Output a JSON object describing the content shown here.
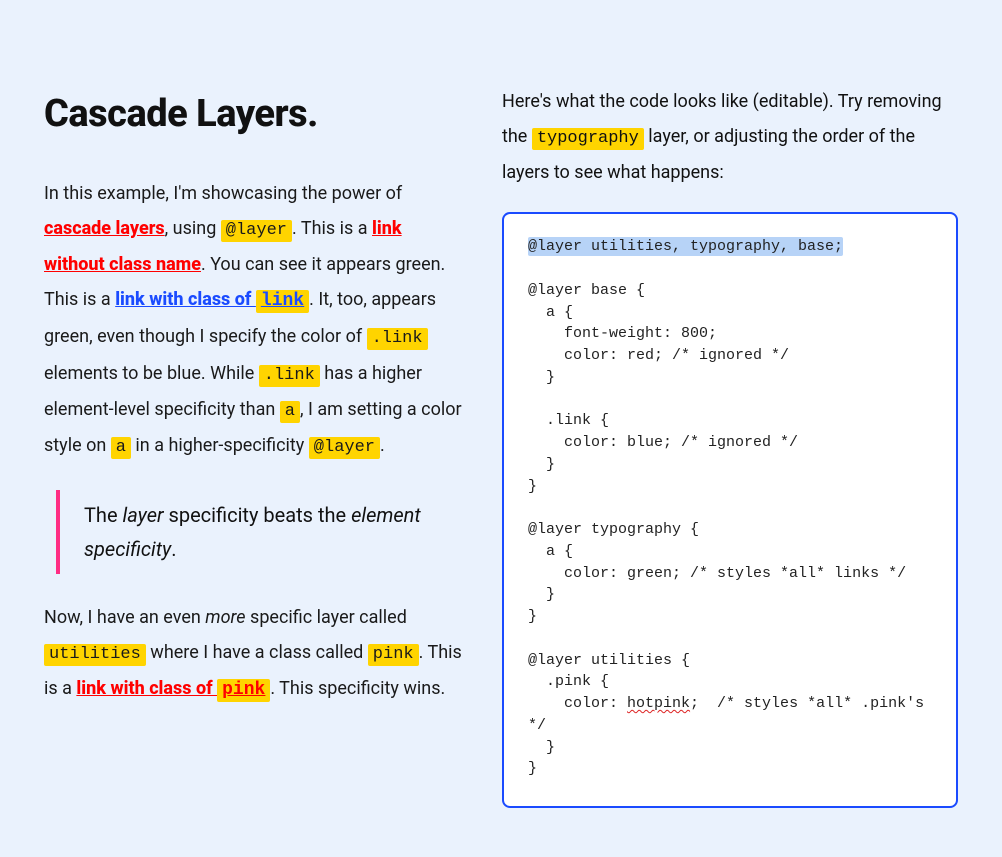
{
  "title": "Cascade Layers.",
  "p1": {
    "t1": "In this example, I'm showcasing the power of ",
    "link1": "cascade layers",
    "t2": ", using ",
    "code1": "@layer",
    "t3": ". This is a ",
    "link2": "link without class name",
    "t4": ". You can see it appears green. This is a ",
    "link3_pre": "link with class of ",
    "link3_code": "link",
    "t5": ". It, too, appears green, even though I specify the color of ",
    "code2": ".link",
    "t6": " elements to be blue. While ",
    "code3": ".link",
    "t7": " has a higher element-level specificity than ",
    "code4": "a",
    "t8": ", I am setting a color style on ",
    "code5": "a",
    "t9": " in a higher-specificity ",
    "code6": "@layer",
    "t10": "."
  },
  "quote": {
    "t1": "The ",
    "em1": "layer",
    "t2": " specificity beats the ",
    "em2": "element specificity",
    "t3": "."
  },
  "p2": {
    "t1": "Now, I have an even ",
    "em1": "more",
    "t2": " specific layer called ",
    "code1": "utilities",
    "t3": " where I have a class called ",
    "code2": "pink",
    "t4": ". This is a ",
    "link1_pre": "link with class of ",
    "link1_code": "pink",
    "t5": ". This specificity wins."
  },
  "right_intro": {
    "t1": "Here's what the code looks like (editable). Try removing the ",
    "code1": "typography",
    "t2": " layer, or adjusting the order of the layers to see what happens:"
  },
  "code": {
    "line_sel": "@layer utilities, typography, base;",
    "block1_open": "@layer base {",
    "a_open": "  a {",
    "a_fw": "    font-weight: 800;",
    "a_red": "    color: red; /* ignored */",
    "close_brace": "  }",
    "link_open": "  .link {",
    "link_blue": "    color: blue; /* ignored */",
    "block_close": "}",
    "typo_open": "@layer typography {",
    "a2_open": "  a {",
    "a2_green": "    color: green; /* styles *all* links */",
    "util_open": "@layer utilities {",
    "pink_open": "  .pink {",
    "pink_pre": "    color: ",
    "pink_word": "hotpink",
    "pink_post": ";  /* styles *all* .pink's */"
  }
}
